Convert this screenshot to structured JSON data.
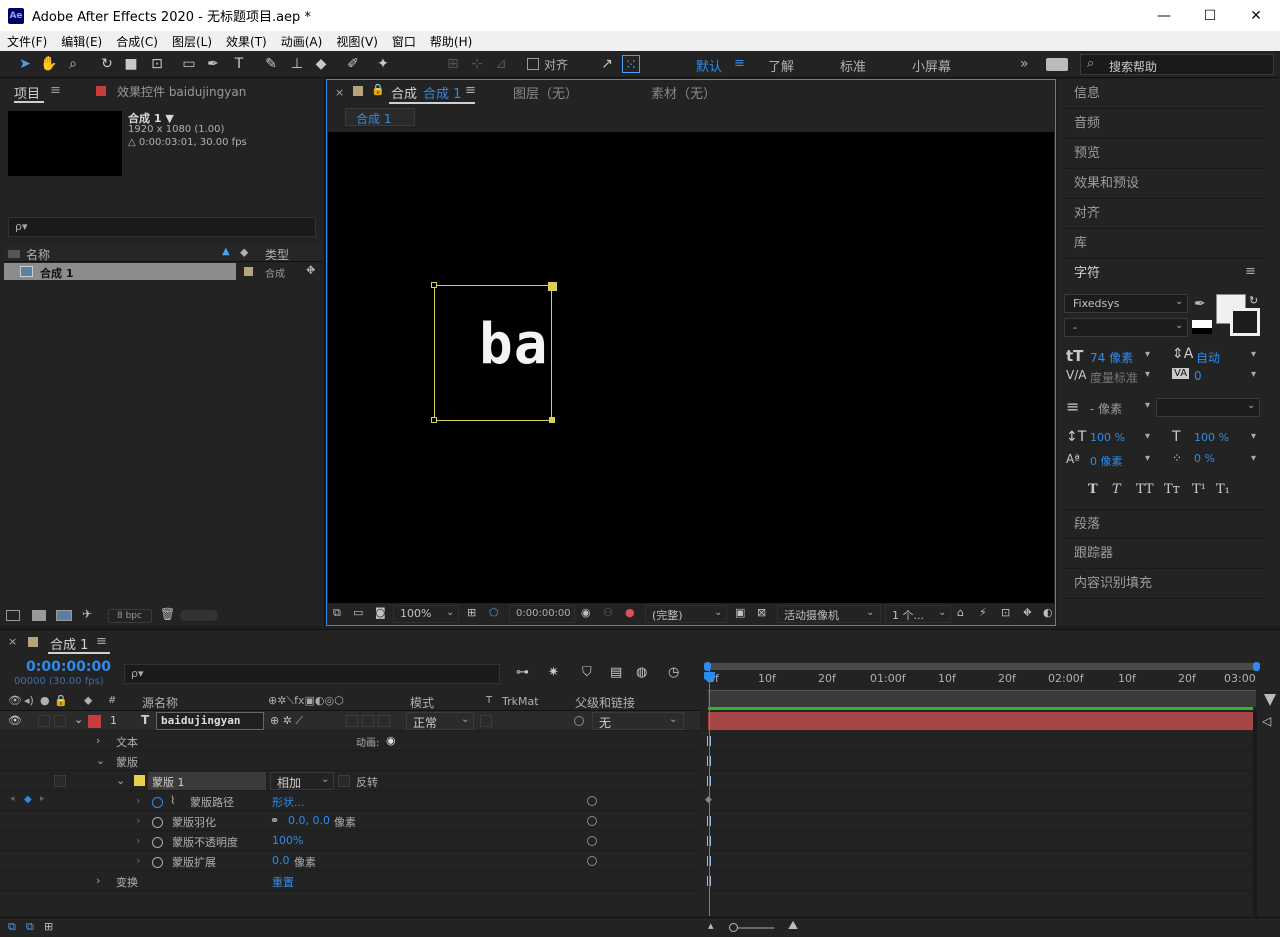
{
  "window": {
    "title": "Adobe After Effects 2020 - 无标题项目.aep *",
    "logo": "Ae",
    "minimize": "—",
    "maximize": "☐",
    "close": "✕"
  },
  "menu": [
    "文件(F)",
    "编辑(E)",
    "合成(C)",
    "图层(L)",
    "效果(T)",
    "动画(A)",
    "视图(V)",
    "窗口",
    "帮助(H)"
  ],
  "toolbar": {
    "align_label": "对齐",
    "workspaces": [
      "默认",
      "了解",
      "标准",
      "小屏幕"
    ],
    "active_workspace": "默认",
    "more": "»",
    "search_placeholder": "搜索帮助"
  },
  "project_panel": {
    "tab": "项目",
    "effects_tab": "效果控件 baidujingyan",
    "comp_name": "合成 1 ▼",
    "comp_size": "1920 x 1080 (1.00)",
    "comp_duration": "△ 0:00:03:01, 30.00 fps",
    "search_placeholder": "ρ▾",
    "col_name": "名称",
    "col_type": "类型",
    "item_name": "合成 1",
    "item_type": "合成",
    "bpc": "8 bpc"
  },
  "comp_viewer": {
    "tab_label": "合成",
    "tab_comp": "合成 1",
    "layer_tab": "图层（无）",
    "footage_tab": "素材（无）",
    "breadcrumb": "合成 1",
    "canvas_text": "ba",
    "zoom": "100%",
    "timecode": "0:00:00:00",
    "resolution": "(完整)",
    "camera": "活动摄像机",
    "views": "1 个..."
  },
  "right_panel": {
    "items": [
      "信息",
      "音频",
      "预览",
      "效果和预设",
      "对齐",
      "库"
    ],
    "character_title": "字符",
    "font": "Fixedsys",
    "font_style": "-",
    "font_size": "74 像素",
    "leading": "自动",
    "kerning": "度量标准",
    "tracking": "0",
    "stroke": "- 像素",
    "vscale": "100 %",
    "hscale": "100 %",
    "baseline": "0 像素",
    "tsume": "0 %",
    "styles": [
      "T",
      "T",
      "TT",
      "Tт",
      "T¹",
      "T₁"
    ],
    "bottom_items": [
      "段落",
      "跟踪器",
      "内容识别填充"
    ]
  },
  "timeline": {
    "tab": "合成 1",
    "timecode": "0:00:00:00",
    "frame_info": "00000 (30.00 fps)",
    "search_placeholder": "ρ▾",
    "col_source": "源名称",
    "col_mode": "模式",
    "col_t": "T",
    "col_trkmat": "TrkMat",
    "col_parent": "父级和链接",
    "ruler": [
      "0f",
      "10f",
      "20f",
      "01:00f",
      "10f",
      "20f",
      "02:00f",
      "10f",
      "20f",
      "03:00"
    ],
    "layer": {
      "index": "1",
      "type_icon": "T",
      "name": "baidujingyan",
      "mode": "正常",
      "parent": "无"
    },
    "rows": {
      "text": "文本",
      "animate": "动画:",
      "masks": "蒙版",
      "mask1": "蒙版 1",
      "mask_mode": "相加",
      "invert": "反转",
      "mask_path": "蒙版路径",
      "mask_path_val": "形状...",
      "mask_feather": "蒙版羽化",
      "mask_feather_val": "0.0, 0.0",
      "mask_feather_unit": "像素",
      "mask_opacity": "蒙版不透明度",
      "mask_opacity_val": "100%",
      "mask_expansion": "蒙版扩展",
      "mask_expansion_val": "0.0",
      "mask_expansion_unit": "像素",
      "transform": "变换",
      "reset": "重置"
    }
  },
  "colors": {
    "accent": "#2d8ceb",
    "layer_bar": "#a64646",
    "label_red": "#c93c3c",
    "label_yellow": "#e6d14a",
    "mask_box": "#d8cf5a"
  }
}
